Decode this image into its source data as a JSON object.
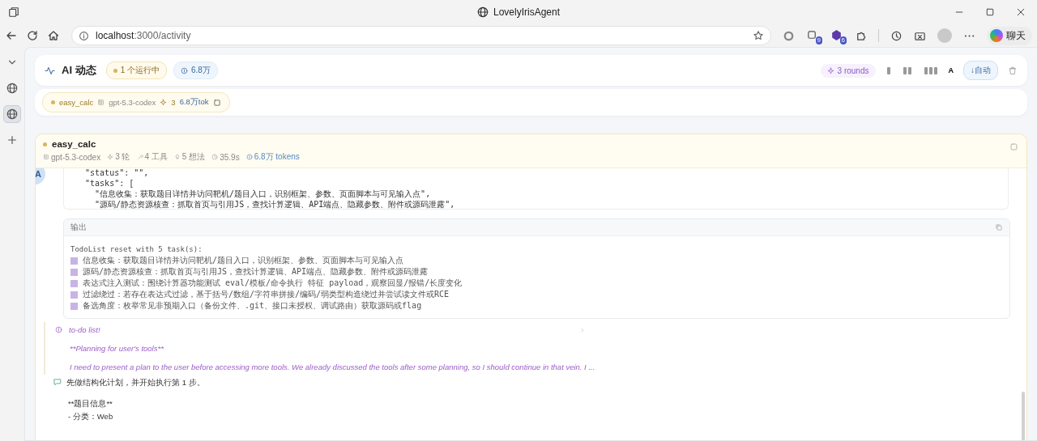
{
  "window": {
    "title": "LovelyIrisAgent"
  },
  "browser": {
    "url_host": "localhost",
    "url_path": ":3000/activity",
    "badges": [
      "9",
      "6"
    ],
    "copilot_label": "聊天"
  },
  "sidebar": {
    "items": [
      {
        "kind": "chevron",
        "selected": false
      },
      {
        "kind": "globe",
        "selected": false
      },
      {
        "kind": "globe",
        "selected": true
      },
      {
        "kind": "plus",
        "selected": false
      }
    ]
  },
  "header": {
    "title": "AI 动态",
    "running": "1 个运行中",
    "tokens": "6.8万",
    "rounds": "3 rounds",
    "layouts": [
      {
        "kind": "one",
        "selected": false
      },
      {
        "kind": "two",
        "selected": false
      },
      {
        "kind": "three",
        "selected": false
      }
    ],
    "font_toggle": "A",
    "auto_scroll": "↓自动"
  },
  "session_chips": [
    {
      "name": "easy_calc",
      "model": "gpt-5.3-codex",
      "rounds": "3",
      "tokens": "6.8万tok"
    }
  ],
  "session": {
    "name": "easy_calc",
    "avatar": "A",
    "meta": [
      {
        "kind": "model",
        "text": "gpt-5.3-codex"
      },
      {
        "kind": "rounds",
        "text": "3 轮"
      },
      {
        "kind": "tools",
        "text": "4 工具"
      },
      {
        "kind": "thoughts",
        "text": "5 想法"
      },
      {
        "kind": "time",
        "text": "35.9s"
      },
      {
        "kind": "tokens",
        "text": "6.8万 tokens"
      }
    ],
    "code_lines": [
      "  \"status\": \"\",",
      "  \"tasks\": [",
      "    \"信息收集：获取题目详情并访问靶机/题目入口，识别框架、参数、页面脚本与可见输入点\",",
      "    \"源码/静态资源核查：抓取首页与引用JS，查找计算逻辑、API端点、隐藏参数、附件或源码泄露\","
    ],
    "output": {
      "title": "输出",
      "summary": "TodoList reset with 5 task(s):",
      "tasks": [
        {
          "text": "信息收集：获取题目详情并访问靶机/题目入口，识别框架、参数、页面脚本与可见输入点",
          "checked": false
        },
        {
          "text": "源码/静态资源核查：抓取首页与引用JS，查找计算逻辑、API端点、隐藏参数、附件或源码泄露",
          "checked": false
        },
        {
          "text": "表达式注入测试：围绕计算器功能测试 eval/模板/命令执行 特征 payload，观察回显/报错/长度变化",
          "checked": false
        },
        {
          "text": "过滤绕过：若存在表达式过滤，基于括号/数组/字符串拼接/编码/弱类型构造绕过并尝试读文件或RCE",
          "checked": false
        },
        {
          "text": "备选角度：枚举常见非预期入口（备份文件、.git、接口未授权、调试路由）获取源码或flag",
          "checked": false
        }
      ]
    },
    "thinking": {
      "title": "to-do list!",
      "paragraphs": [
        "**Planning for user's tools**",
        "I need to present a plan to the user before accessing more tools. We already discussed the tools after some planning, so I should continue in that vein. I ..."
      ]
    },
    "message": {
      "paragraphs": [
        "先做结构化计划，并开始执行第 1 步。",
        "**题目信息**",
        "- 分类：Web"
      ]
    }
  }
}
